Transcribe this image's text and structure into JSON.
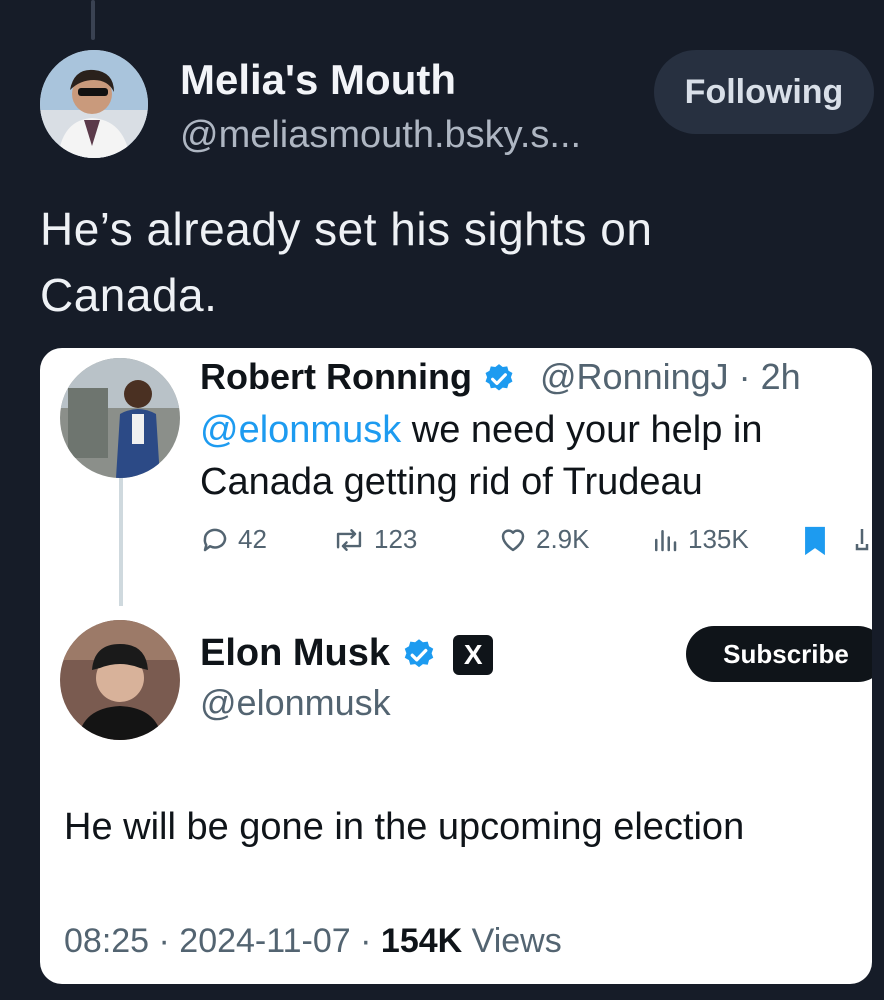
{
  "post": {
    "author_name": "Melia's Mouth",
    "author_handle": "@meliasmouth.bsky.s...",
    "follow_label": "Following",
    "text": "He’s already set his sights on Canada."
  },
  "embed": {
    "reply": {
      "name": "Robert Ronning",
      "handle": "@RonningJ · 2h",
      "mention": "@elonmusk",
      "text": " we need your help in Canada getting rid of Trudeau",
      "stats": {
        "replies": "42",
        "reposts": "123",
        "likes": "2.9K",
        "views": "135K"
      }
    },
    "tweet": {
      "name": "Elon Musk",
      "x_badge": "X",
      "handle": "@elonmusk",
      "subscribe_label": "Subscribe",
      "text": "He will be gone in the upcoming election",
      "time_date": "08:25 · 2024-11-07 · ",
      "views_count": "154K",
      "views_label": " Views"
    }
  },
  "colors": {
    "background": "#161c28",
    "verified": "#1d9bf0",
    "bookmark": "#1d9bf0"
  }
}
